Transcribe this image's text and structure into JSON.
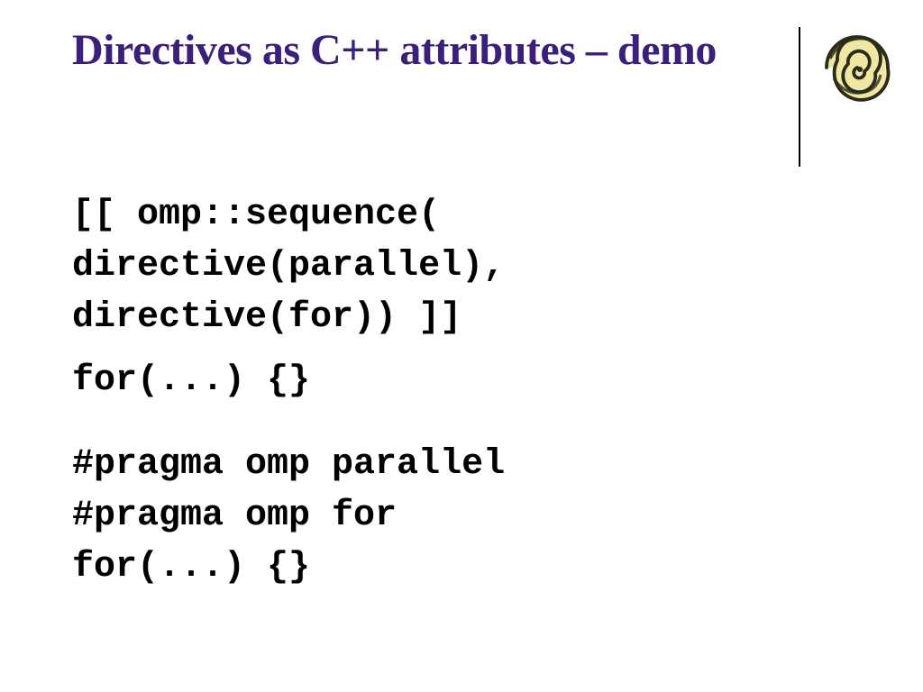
{
  "slide": {
    "title": "Directives as C++ attributes – demo",
    "code": {
      "block1": {
        "line1": "[[ omp::sequence(",
        "line2": "directive(parallel),",
        "line3": "directive(for)) ]]",
        "line4": "for(...) {}"
      },
      "block2": {
        "line1": "#pragma omp parallel",
        "line2": "#pragma omp for",
        "line3": "for(...) {}"
      }
    }
  }
}
